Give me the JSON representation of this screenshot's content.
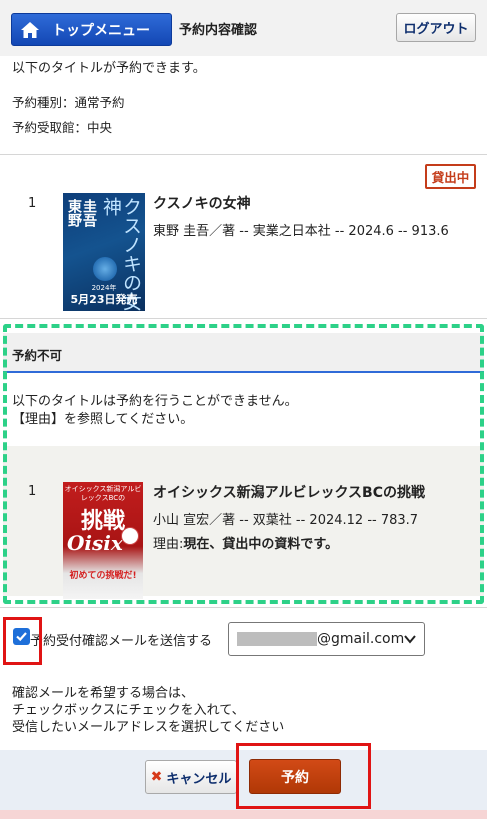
{
  "header": {
    "top_menu_label": "トップメニュー",
    "page_title": "予約内容確認",
    "logout_label": "ログアウト"
  },
  "reservable": {
    "intro": "以下のタイトルが予約できます。",
    "type_line": "予約種別：通常予約",
    "pickup_line": "予約受取館：中央",
    "items": [
      {
        "index": "1",
        "status": "貸出中",
        "title": "クスノキの女神",
        "meta": "東野 圭吾／著 -- 実業之日本社 -- 2024.6 -- 913.6",
        "cover": {
          "author_a": "東野",
          "author_b": "圭吾",
          "title": "クスノキの女神",
          "year": "2024年",
          "release": "5月23日発売"
        }
      }
    ]
  },
  "unavailable": {
    "heading": "予約不可",
    "message_line1": "以下のタイトルは予約を行うことができません。",
    "message_line2": "【理由】を参照してください。",
    "items": [
      {
        "index": "1",
        "title": "オイシックス新潟アルビレックスBCの挑戦",
        "meta": "小山 宣宏／著 -- 双葉社 -- 2024.12 -- 783.7",
        "reason_label": "理由:",
        "reason": "現在、貸出中の資料です。",
        "cover": {
          "sub": "オイシックス新潟アルビレックスBCの",
          "big": "挑戦",
          "logo": "Oisix",
          "tagline": "初めての挑戦だ!"
        }
      }
    ]
  },
  "email": {
    "checked": true,
    "label": "予約受付確認メールを送信する",
    "selected_domain": "@gmail.com"
  },
  "notes": [
    "確認メールを希望する場合は、",
    "チェックボックスにチェックを入れて、",
    "受信したいメールアドレスを選択してください"
  ],
  "actions": {
    "cancel_label": "キャンセル",
    "reserve_label": "予約"
  },
  "colors": {
    "primary": "#1347b4",
    "reserve": "#c04010",
    "status": "#c43c1a",
    "highlight_dashed": "#2dd188",
    "highlight_red": "#e01414"
  }
}
